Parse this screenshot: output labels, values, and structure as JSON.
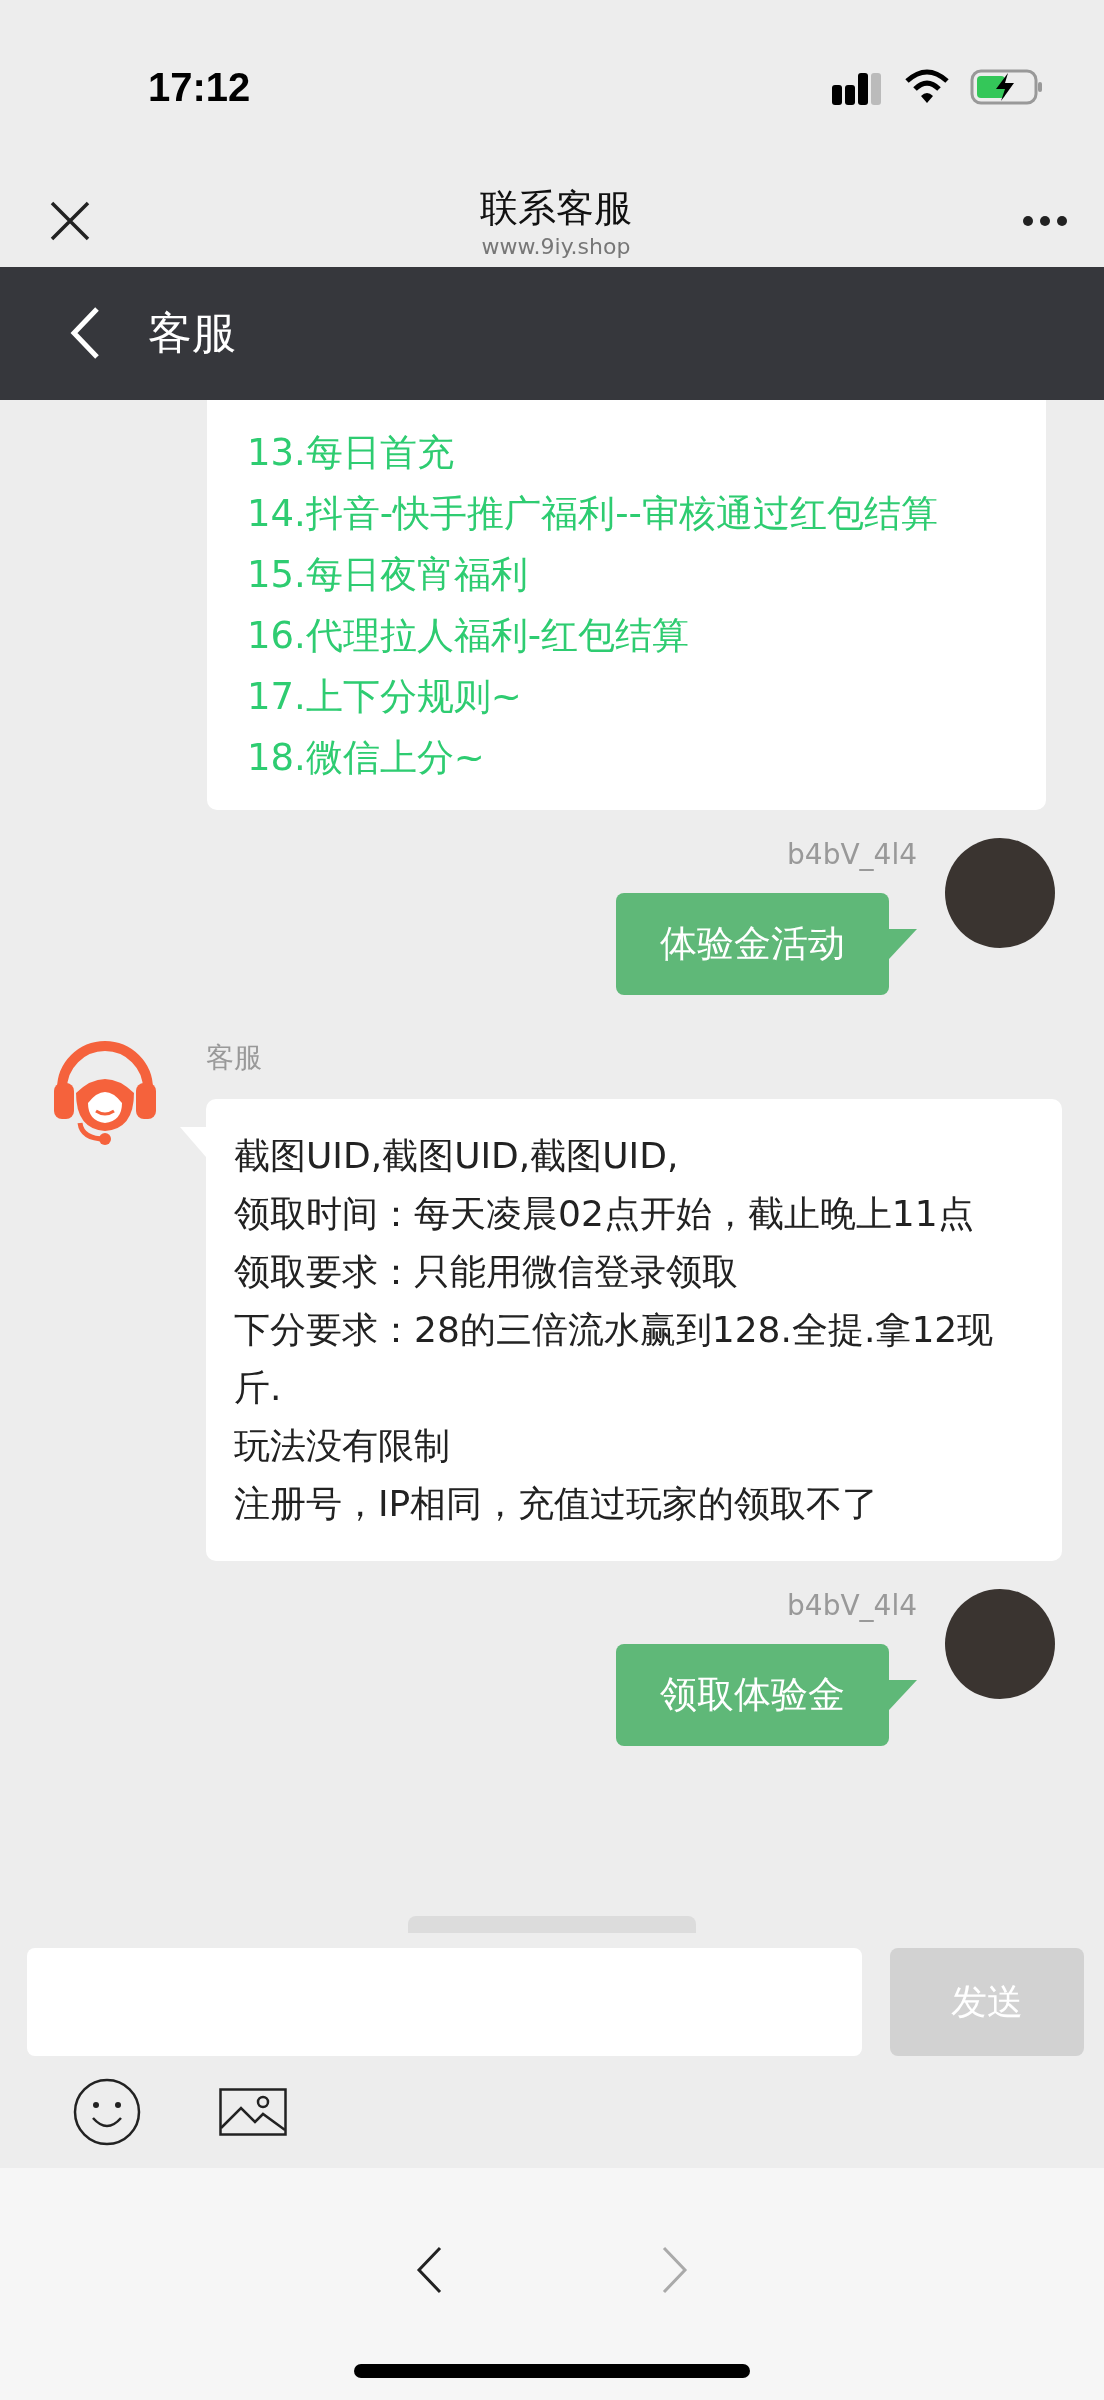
{
  "status_bar": {
    "time": "17:12"
  },
  "header": {
    "title": "联系客服",
    "subtitle": "www.9iy.shop"
  },
  "subheader": {
    "title": "客服"
  },
  "messages": [
    {
      "kind": "menu",
      "items": [
        "13.每日首充",
        "14.抖音-快手推广福利--审核通过红包结算",
        "15.每日夜宵福利",
        "16.代理拉人福利-红包结算",
        "17.上下分规则~",
        "18.微信上分~"
      ]
    },
    {
      "kind": "user",
      "sender": "b4bV_4l4",
      "text": "体验金活动"
    },
    {
      "kind": "agent",
      "sender": "客服",
      "lines": [
        "截图UID,截图UID,截图UID,",
        "领取时间：每天凌晨02点开始，截止晚上11点",
        "领取要求：只能用微信登录领取",
        "下分要求：28的三倍流水赢到128.全提.拿12现斤.",
        "玩法没有限制",
        "注册号，IP相同，充值过玩家的领取不了"
      ]
    },
    {
      "kind": "user",
      "sender": "b4bV_4l4",
      "text": "领取体验金"
    }
  ],
  "composer": {
    "send_label": "发送",
    "send_disabled": true
  },
  "browser_nav": {
    "back_disabled": false,
    "forward_disabled": true
  }
}
